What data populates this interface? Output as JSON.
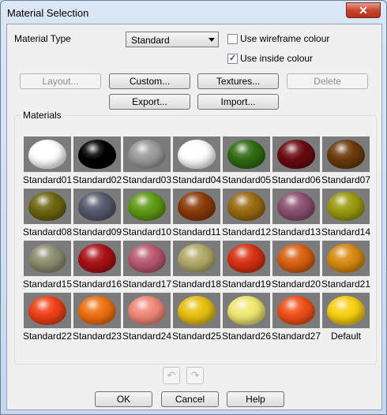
{
  "window": {
    "title": "Material Selection",
    "close_glyph": "✕"
  },
  "material_type": {
    "label": "Material Type",
    "value": "Standard"
  },
  "options": {
    "wireframe": {
      "label": "Use wireframe colour",
      "checked": false
    },
    "inside": {
      "label": "Use inside colour",
      "checked": true
    }
  },
  "buttons": {
    "layout": "Layout...",
    "custom": "Custom...",
    "textures": "Textures...",
    "delete": "Delete",
    "export": "Export...",
    "import": "Import...",
    "ok": "OK",
    "cancel": "Cancel",
    "help": "Help"
  },
  "materials": {
    "group_label": "Materials",
    "items": [
      {
        "name": "Standard01",
        "color": "#ffffff"
      },
      {
        "name": "Standard02",
        "color": "#000000"
      },
      {
        "name": "Standard03",
        "color": "#9a9a9a"
      },
      {
        "name": "Standard04",
        "color": "#ffffff"
      },
      {
        "name": "Standard05",
        "color": "#2f6b12"
      },
      {
        "name": "Standard06",
        "color": "#6a0a10"
      },
      {
        "name": "Standard07",
        "color": "#6a3a0a"
      },
      {
        "name": "Standard08",
        "color": "#6c6510"
      },
      {
        "name": "Standard09",
        "color": "#555a6c"
      },
      {
        "name": "Standard10",
        "color": "#5e9a14"
      },
      {
        "name": "Standard11",
        "color": "#8a3a08"
      },
      {
        "name": "Standard12",
        "color": "#9a6a10"
      },
      {
        "name": "Standard13",
        "color": "#8a5070"
      },
      {
        "name": "Standard14",
        "color": "#9a9a10"
      },
      {
        "name": "Standard15",
        "color": "#8c8c70"
      },
      {
        "name": "Standard16",
        "color": "#a81015"
      },
      {
        "name": "Standard17",
        "color": "#b85870"
      },
      {
        "name": "Standard18",
        "color": "#b0aa68"
      },
      {
        "name": "Standard19",
        "color": "#d83010"
      },
      {
        "name": "Standard20",
        "color": "#d86010"
      },
      {
        "name": "Standard21",
        "color": "#d88a10"
      },
      {
        "name": "Standard22",
        "color": "#f04018"
      },
      {
        "name": "Standard23",
        "color": "#f07010"
      },
      {
        "name": "Standard24",
        "color": "#f08878"
      },
      {
        "name": "Standard25",
        "color": "#e8c010"
      },
      {
        "name": "Standard26",
        "color": "#f0e870"
      },
      {
        "name": "Standard27",
        "color": "#f05018"
      },
      {
        "name": "Default",
        "color": "#f8d010"
      }
    ]
  },
  "history": {
    "undo_glyph": "↶",
    "redo_glyph": "↷"
  }
}
